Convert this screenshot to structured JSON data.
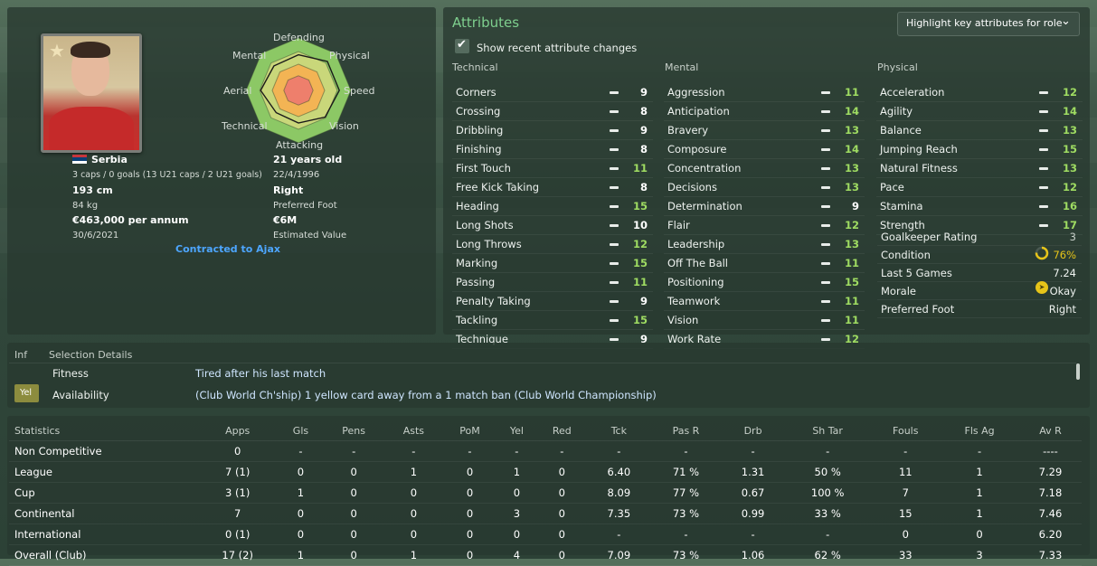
{
  "profile": {
    "nationality": "Serbia",
    "caps": "3 caps / 0 goals (13 U21 caps / 2 U21 goals)",
    "age": "21 years old",
    "dob": "22/4/1996",
    "height": "193 cm",
    "weight": "84 kg",
    "preferred_foot": "Right",
    "preferred_foot_label": "Preferred Foot",
    "wage": "€463,000 per annum",
    "contract_end": "30/6/2021",
    "value": "€6M",
    "value_label": "Estimated Value",
    "contract_status": "Contracted to Ajax"
  },
  "radar": {
    "labels": [
      "Defending",
      "Physical",
      "Speed",
      "Vision",
      "Attacking",
      "Technical",
      "Aerial",
      "Mental"
    ],
    "values": [
      0.68,
      0.78,
      0.78,
      0.72,
      0.62,
      0.6,
      0.72,
      0.66
    ],
    "colors": {
      "outer": "#8cc865",
      "mid": "#c9d77a",
      "inner": "#f3b454",
      "core": "#ee7f6c"
    }
  },
  "attributes": {
    "title": "Attributes",
    "role_dropdown": "Highlight key attributes for role",
    "show_changes": "Show recent attribute changes",
    "technical_title": "Technical",
    "mental_title": "Mental",
    "physical_title": "Physical",
    "technical": [
      {
        "name": "Corners",
        "value": "9"
      },
      {
        "name": "Crossing",
        "value": "8"
      },
      {
        "name": "Dribbling",
        "value": "9"
      },
      {
        "name": "Finishing",
        "value": "8"
      },
      {
        "name": "First Touch",
        "value": "11"
      },
      {
        "name": "Free Kick Taking",
        "value": "8"
      },
      {
        "name": "Heading",
        "value": "15"
      },
      {
        "name": "Long Shots",
        "value": "10"
      },
      {
        "name": "Long Throws",
        "value": "12"
      },
      {
        "name": "Marking",
        "value": "15"
      },
      {
        "name": "Passing",
        "value": "11"
      },
      {
        "name": "Penalty Taking",
        "value": "9"
      },
      {
        "name": "Tackling",
        "value": "15"
      },
      {
        "name": "Technique",
        "value": "9"
      }
    ],
    "mental": [
      {
        "name": "Aggression",
        "value": "11"
      },
      {
        "name": "Anticipation",
        "value": "14"
      },
      {
        "name": "Bravery",
        "value": "13"
      },
      {
        "name": "Composure",
        "value": "14"
      },
      {
        "name": "Concentration",
        "value": "13"
      },
      {
        "name": "Decisions",
        "value": "13"
      },
      {
        "name": "Determination",
        "value": "9"
      },
      {
        "name": "Flair",
        "value": "12"
      },
      {
        "name": "Leadership",
        "value": "13"
      },
      {
        "name": "Off The Ball",
        "value": "11"
      },
      {
        "name": "Positioning",
        "value": "15"
      },
      {
        "name": "Teamwork",
        "value": "11"
      },
      {
        "name": "Vision",
        "value": "11"
      },
      {
        "name": "Work Rate",
        "value": "12"
      }
    ],
    "physical": [
      {
        "name": "Acceleration",
        "value": "12"
      },
      {
        "name": "Agility",
        "value": "14"
      },
      {
        "name": "Balance",
        "value": "13"
      },
      {
        "name": "Jumping Reach",
        "value": "15"
      },
      {
        "name": "Natural Fitness",
        "value": "13"
      },
      {
        "name": "Pace",
        "value": "12"
      },
      {
        "name": "Stamina",
        "value": "16"
      },
      {
        "name": "Strength",
        "value": "17"
      }
    ],
    "other": [
      {
        "name": "Goalkeeper Rating",
        "value": "3"
      },
      {
        "name": "Condition",
        "value": "76%"
      },
      {
        "name": "Last 5 Games",
        "value": "7.24"
      },
      {
        "name": "Morale",
        "value": "Okay"
      },
      {
        "name": "Preferred Foot",
        "value": "Right"
      }
    ],
    "condition_fraction": 0.76,
    "value_colors": {
      "normal": "#ffffff",
      "good": "#9fdc62",
      "accent": "#e6c419"
    }
  },
  "selection": {
    "inf_header": "Inf",
    "title": "Selection Details",
    "rows": [
      {
        "tag": "",
        "label": "Fitness",
        "value": "Tired after his last match"
      },
      {
        "tag": "Yel",
        "label": "Availability",
        "value": "(Club World Ch'ship) 1 yellow card away from a 1 match ban (Club World Championship)"
      }
    ]
  },
  "statistics": {
    "title": "Statistics",
    "columns": [
      "Apps",
      "Gls",
      "Pens",
      "Asts",
      "PoM",
      "Yel",
      "Red",
      "Tck",
      "Pas R",
      "Drb",
      "Sh Tar",
      "Fouls",
      "Fls Ag",
      "Av R"
    ],
    "rows": [
      {
        "name": "Non Competitive",
        "cells": [
          "0",
          "-",
          "-",
          "-",
          "-",
          "-",
          "-",
          "-",
          "-",
          "-",
          "-",
          "-",
          "-",
          "----"
        ]
      },
      {
        "name": "League",
        "cells": [
          "7 (1)",
          "0",
          "0",
          "1",
          "0",
          "1",
          "0",
          "6.40",
          "71 %",
          "1.31",
          "50 %",
          "11",
          "1",
          "7.29"
        ]
      },
      {
        "name": "Cup",
        "cells": [
          "3 (1)",
          "1",
          "0",
          "0",
          "0",
          "0",
          "0",
          "8.09",
          "77 %",
          "0.67",
          "100 %",
          "7",
          "1",
          "7.18"
        ]
      },
      {
        "name": "Continental",
        "cells": [
          "7",
          "0",
          "0",
          "0",
          "0",
          "3",
          "0",
          "7.35",
          "73 %",
          "0.99",
          "33 %",
          "15",
          "1",
          "7.46"
        ]
      },
      {
        "name": "International",
        "cells": [
          "0 (1)",
          "0",
          "0",
          "0",
          "0",
          "0",
          "0",
          "-",
          "-",
          "-",
          "-",
          "0",
          "0",
          "6.20"
        ]
      },
      {
        "name": "Overall (Club)",
        "cells": [
          "17 (2)",
          "1",
          "0",
          "1",
          "0",
          "4",
          "0",
          "7.09",
          "73 %",
          "1.06",
          "62 %",
          "33",
          "3",
          "7.33"
        ]
      }
    ]
  }
}
